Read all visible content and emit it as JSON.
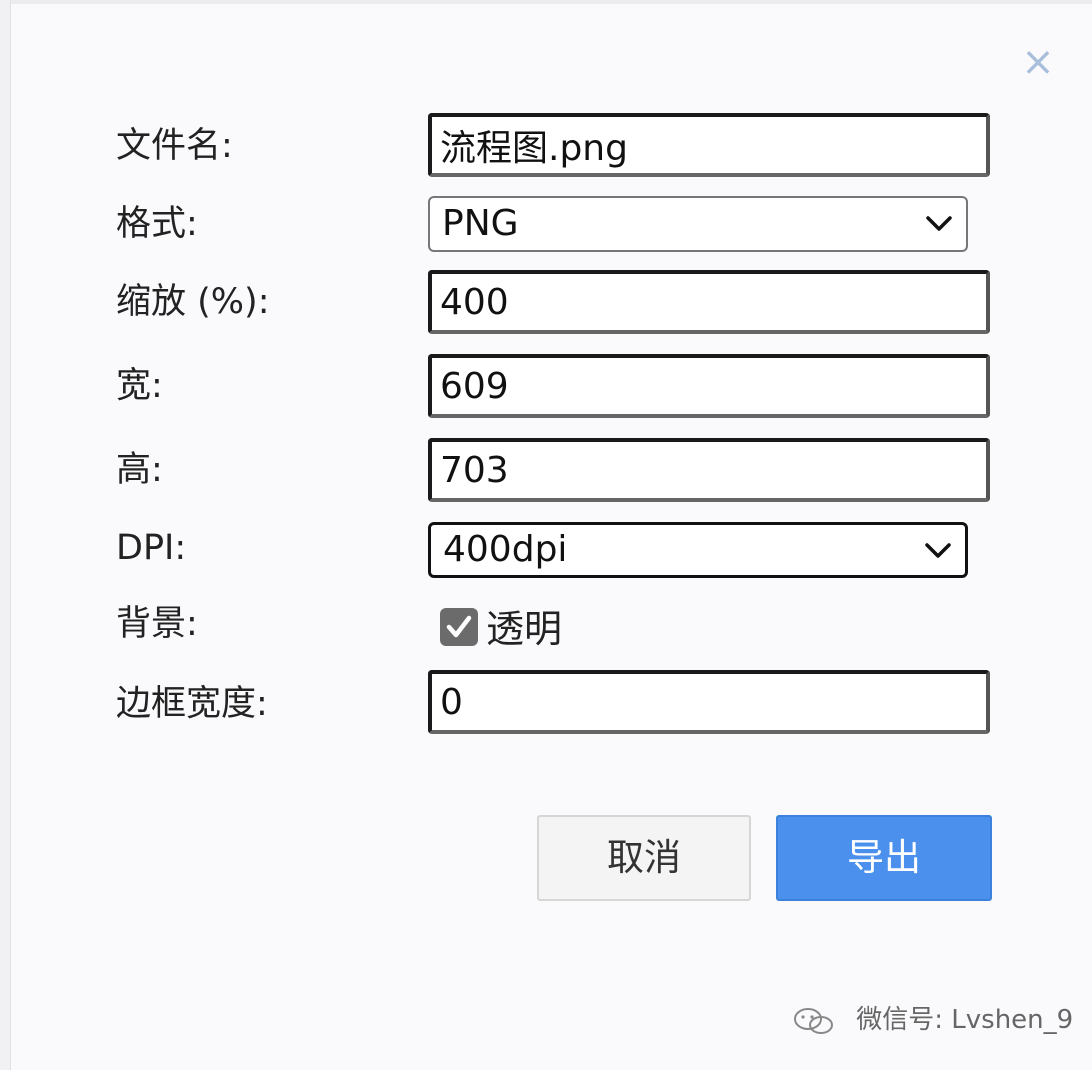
{
  "dialog": {
    "close_label": "×",
    "fields": {
      "filename": {
        "label": "文件名:",
        "value": "流程图.png"
      },
      "format": {
        "label": "格式:",
        "selected": "PNG"
      },
      "zoom": {
        "label": "缩放 (%):",
        "value": "400"
      },
      "width": {
        "label": "宽:",
        "value": "609"
      },
      "height": {
        "label": "高:",
        "value": "703"
      },
      "dpi": {
        "label": "DPI:",
        "selected": "400dpi"
      },
      "background": {
        "label": "背景:",
        "checkbox_label": "透明",
        "checked": true
      },
      "border_width": {
        "label": "边框宽度:",
        "value": "0"
      }
    },
    "buttons": {
      "cancel": "取消",
      "export": "导出"
    }
  },
  "watermark": {
    "text": "微信号: Lvshen_9"
  },
  "colors": {
    "accent": "#4a90ec",
    "close_icon": "#a8bedb",
    "checkbox": "#6b6b6b"
  }
}
